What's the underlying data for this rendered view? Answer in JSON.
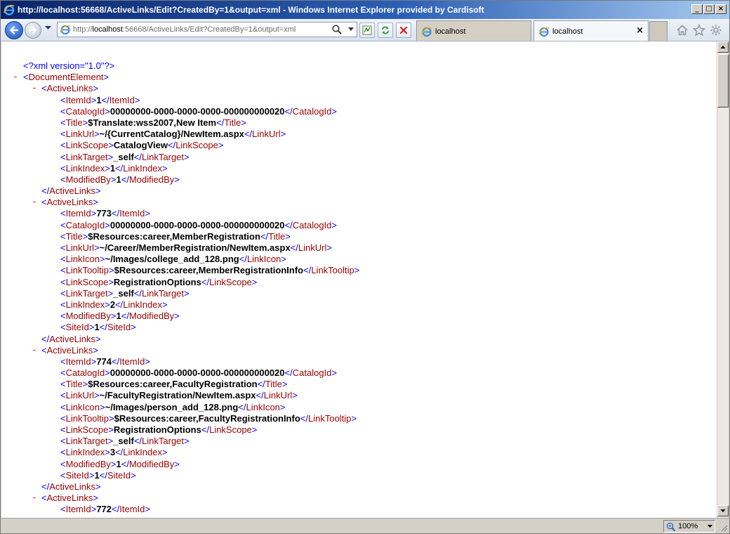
{
  "window": {
    "title": "http://localhost:56668/ActiveLinks/Edit?CreatedBy=1&output=xml - Windows Internet Explorer provided by Cardisoft",
    "minimize_glyph": "_",
    "maximize_glyph": "□",
    "close_glyph": "×"
  },
  "address": {
    "scheme": "http://",
    "host": "localhost",
    "rest": ":56668/ActiveLinks/Edit?CreatedBy=1&output=xml"
  },
  "tabs": [
    {
      "label": "localhost",
      "close": ""
    },
    {
      "label": "localhost",
      "close": "×"
    }
  ],
  "xml": {
    "lines": [
      {
        "indent": 1,
        "minus": false,
        "parts": [
          [
            "pi",
            "<?xml version=\"1.0\"?>"
          ]
        ]
      },
      {
        "indent": 1,
        "minus": true,
        "parts": [
          [
            "b",
            "<"
          ],
          [
            "tn",
            "DocumentElement"
          ],
          [
            "b",
            ">"
          ]
        ]
      },
      {
        "indent": 2,
        "minus": true,
        "parts": [
          [
            "b",
            "<"
          ],
          [
            "tn",
            "ActiveLinks"
          ],
          [
            "b",
            ">"
          ]
        ]
      },
      {
        "indent": 3,
        "minus": false,
        "parts": [
          [
            "b",
            "<"
          ],
          [
            "tn",
            "ItemId"
          ],
          [
            "b",
            ">"
          ],
          [
            "val",
            "1"
          ],
          [
            "b",
            "</"
          ],
          [
            "tn",
            "ItemId"
          ],
          [
            "b",
            ">"
          ]
        ]
      },
      {
        "indent": 3,
        "minus": false,
        "parts": [
          [
            "b",
            "<"
          ],
          [
            "tn",
            "CatalogId"
          ],
          [
            "b",
            ">"
          ],
          [
            "val",
            "00000000-0000-0000-0000-000000000020"
          ],
          [
            "b",
            "</"
          ],
          [
            "tn",
            "CatalogId"
          ],
          [
            "b",
            ">"
          ]
        ]
      },
      {
        "indent": 3,
        "minus": false,
        "parts": [
          [
            "b",
            "<"
          ],
          [
            "tn",
            "Title"
          ],
          [
            "b",
            ">"
          ],
          [
            "val",
            "$Translate:wss2007,New Item"
          ],
          [
            "b",
            "</"
          ],
          [
            "tn",
            "Title"
          ],
          [
            "b",
            ">"
          ]
        ]
      },
      {
        "indent": 3,
        "minus": false,
        "parts": [
          [
            "b",
            "<"
          ],
          [
            "tn",
            "LinkUrl"
          ],
          [
            "b",
            ">"
          ],
          [
            "val",
            "~/{CurrentCatalog}/NewItem.aspx"
          ],
          [
            "b",
            "</"
          ],
          [
            "tn",
            "LinkUrl"
          ],
          [
            "b",
            ">"
          ]
        ]
      },
      {
        "indent": 3,
        "minus": false,
        "parts": [
          [
            "b",
            "<"
          ],
          [
            "tn",
            "LinkScope"
          ],
          [
            "b",
            ">"
          ],
          [
            "val",
            "CatalogView"
          ],
          [
            "b",
            "</"
          ],
          [
            "tn",
            "LinkScope"
          ],
          [
            "b",
            ">"
          ]
        ]
      },
      {
        "indent": 3,
        "minus": false,
        "parts": [
          [
            "b",
            "<"
          ],
          [
            "tn",
            "LinkTarget"
          ],
          [
            "b",
            ">"
          ],
          [
            "val",
            "_self"
          ],
          [
            "b",
            "</"
          ],
          [
            "tn",
            "LinkTarget"
          ],
          [
            "b",
            ">"
          ]
        ]
      },
      {
        "indent": 3,
        "minus": false,
        "parts": [
          [
            "b",
            "<"
          ],
          [
            "tn",
            "LinkIndex"
          ],
          [
            "b",
            ">"
          ],
          [
            "val",
            "1"
          ],
          [
            "b",
            "</"
          ],
          [
            "tn",
            "LinkIndex"
          ],
          [
            "b",
            ">"
          ]
        ]
      },
      {
        "indent": 3,
        "minus": false,
        "parts": [
          [
            "b",
            "<"
          ],
          [
            "tn",
            "ModifiedBy"
          ],
          [
            "b",
            ">"
          ],
          [
            "val",
            "1"
          ],
          [
            "b",
            "</"
          ],
          [
            "tn",
            "ModifiedBy"
          ],
          [
            "b",
            ">"
          ]
        ]
      },
      {
        "indent": 2,
        "minus": false,
        "parts": [
          [
            "b",
            "</"
          ],
          [
            "tn",
            "ActiveLinks"
          ],
          [
            "b",
            ">"
          ]
        ]
      },
      {
        "indent": 2,
        "minus": true,
        "parts": [
          [
            "b",
            "<"
          ],
          [
            "tn",
            "ActiveLinks"
          ],
          [
            "b",
            ">"
          ]
        ]
      },
      {
        "indent": 3,
        "minus": false,
        "parts": [
          [
            "b",
            "<"
          ],
          [
            "tn",
            "ItemId"
          ],
          [
            "b",
            ">"
          ],
          [
            "val",
            "773"
          ],
          [
            "b",
            "</"
          ],
          [
            "tn",
            "ItemId"
          ],
          [
            "b",
            ">"
          ]
        ]
      },
      {
        "indent": 3,
        "minus": false,
        "parts": [
          [
            "b",
            "<"
          ],
          [
            "tn",
            "CatalogId"
          ],
          [
            "b",
            ">"
          ],
          [
            "val",
            "00000000-0000-0000-0000-000000000020"
          ],
          [
            "b",
            "</"
          ],
          [
            "tn",
            "CatalogId"
          ],
          [
            "b",
            ">"
          ]
        ]
      },
      {
        "indent": 3,
        "minus": false,
        "parts": [
          [
            "b",
            "<"
          ],
          [
            "tn",
            "Title"
          ],
          [
            "b",
            ">"
          ],
          [
            "val",
            "$Resources:career,MemberRegistration"
          ],
          [
            "b",
            "</"
          ],
          [
            "tn",
            "Title"
          ],
          [
            "b",
            ">"
          ]
        ]
      },
      {
        "indent": 3,
        "minus": false,
        "parts": [
          [
            "b",
            "<"
          ],
          [
            "tn",
            "LinkUrl"
          ],
          [
            "b",
            ">"
          ],
          [
            "val",
            "~/Career/MemberRegistration/NewItem.aspx"
          ],
          [
            "b",
            "</"
          ],
          [
            "tn",
            "LinkUrl"
          ],
          [
            "b",
            ">"
          ]
        ]
      },
      {
        "indent": 3,
        "minus": false,
        "parts": [
          [
            "b",
            "<"
          ],
          [
            "tn",
            "LinkIcon"
          ],
          [
            "b",
            ">"
          ],
          [
            "val",
            "~/Images/college_add_128.png"
          ],
          [
            "b",
            "</"
          ],
          [
            "tn",
            "LinkIcon"
          ],
          [
            "b",
            ">"
          ]
        ]
      },
      {
        "indent": 3,
        "minus": false,
        "parts": [
          [
            "b",
            "<"
          ],
          [
            "tn",
            "LinkTooltip"
          ],
          [
            "b",
            ">"
          ],
          [
            "val",
            "$Resources:career,MemberRegistrationInfo"
          ],
          [
            "b",
            "</"
          ],
          [
            "tn",
            "LinkTooltip"
          ],
          [
            "b",
            ">"
          ]
        ]
      },
      {
        "indent": 3,
        "minus": false,
        "parts": [
          [
            "b",
            "<"
          ],
          [
            "tn",
            "LinkScope"
          ],
          [
            "b",
            ">"
          ],
          [
            "val",
            "RegistrationOptions"
          ],
          [
            "b",
            "</"
          ],
          [
            "tn",
            "LinkScope"
          ],
          [
            "b",
            ">"
          ]
        ]
      },
      {
        "indent": 3,
        "minus": false,
        "parts": [
          [
            "b",
            "<"
          ],
          [
            "tn",
            "LinkTarget"
          ],
          [
            "b",
            ">"
          ],
          [
            "val",
            "_self"
          ],
          [
            "b",
            "</"
          ],
          [
            "tn",
            "LinkTarget"
          ],
          [
            "b",
            ">"
          ]
        ]
      },
      {
        "indent": 3,
        "minus": false,
        "parts": [
          [
            "b",
            "<"
          ],
          [
            "tn",
            "LinkIndex"
          ],
          [
            "b",
            ">"
          ],
          [
            "val",
            "2"
          ],
          [
            "b",
            "</"
          ],
          [
            "tn",
            "LinkIndex"
          ],
          [
            "b",
            ">"
          ]
        ]
      },
      {
        "indent": 3,
        "minus": false,
        "parts": [
          [
            "b",
            "<"
          ],
          [
            "tn",
            "ModifiedBy"
          ],
          [
            "b",
            ">"
          ],
          [
            "val",
            "1"
          ],
          [
            "b",
            "</"
          ],
          [
            "tn",
            "ModifiedBy"
          ],
          [
            "b",
            ">"
          ]
        ]
      },
      {
        "indent": 3,
        "minus": false,
        "parts": [
          [
            "b",
            "<"
          ],
          [
            "tn",
            "SiteId"
          ],
          [
            "b",
            ">"
          ],
          [
            "val",
            "1"
          ],
          [
            "b",
            "</"
          ],
          [
            "tn",
            "SiteId"
          ],
          [
            "b",
            ">"
          ]
        ]
      },
      {
        "indent": 2,
        "minus": false,
        "parts": [
          [
            "b",
            "</"
          ],
          [
            "tn",
            "ActiveLinks"
          ],
          [
            "b",
            ">"
          ]
        ]
      },
      {
        "indent": 2,
        "minus": true,
        "parts": [
          [
            "b",
            "<"
          ],
          [
            "tn",
            "ActiveLinks"
          ],
          [
            "b",
            ">"
          ]
        ]
      },
      {
        "indent": 3,
        "minus": false,
        "parts": [
          [
            "b",
            "<"
          ],
          [
            "tn",
            "ItemId"
          ],
          [
            "b",
            ">"
          ],
          [
            "val",
            "774"
          ],
          [
            "b",
            "</"
          ],
          [
            "tn",
            "ItemId"
          ],
          [
            "b",
            ">"
          ]
        ]
      },
      {
        "indent": 3,
        "minus": false,
        "parts": [
          [
            "b",
            "<"
          ],
          [
            "tn",
            "CatalogId"
          ],
          [
            "b",
            ">"
          ],
          [
            "val",
            "00000000-0000-0000-0000-000000000020"
          ],
          [
            "b",
            "</"
          ],
          [
            "tn",
            "CatalogId"
          ],
          [
            "b",
            ">"
          ]
        ]
      },
      {
        "indent": 3,
        "minus": false,
        "parts": [
          [
            "b",
            "<"
          ],
          [
            "tn",
            "Title"
          ],
          [
            "b",
            ">"
          ],
          [
            "val",
            "$Resources:career,FacultyRegistration"
          ],
          [
            "b",
            "</"
          ],
          [
            "tn",
            "Title"
          ],
          [
            "b",
            ">"
          ]
        ]
      },
      {
        "indent": 3,
        "minus": false,
        "parts": [
          [
            "b",
            "<"
          ],
          [
            "tn",
            "LinkUrl"
          ],
          [
            "b",
            ">"
          ],
          [
            "val",
            "~/FacultyRegistration/NewItem.aspx"
          ],
          [
            "b",
            "</"
          ],
          [
            "tn",
            "LinkUrl"
          ],
          [
            "b",
            ">"
          ]
        ]
      },
      {
        "indent": 3,
        "minus": false,
        "parts": [
          [
            "b",
            "<"
          ],
          [
            "tn",
            "LinkIcon"
          ],
          [
            "b",
            ">"
          ],
          [
            "val",
            "~/Images/person_add_128.png"
          ],
          [
            "b",
            "</"
          ],
          [
            "tn",
            "LinkIcon"
          ],
          [
            "b",
            ">"
          ]
        ]
      },
      {
        "indent": 3,
        "minus": false,
        "parts": [
          [
            "b",
            "<"
          ],
          [
            "tn",
            "LinkTooltip"
          ],
          [
            "b",
            ">"
          ],
          [
            "val",
            "$Resources:career,FacultyRegistrationInfo"
          ],
          [
            "b",
            "</"
          ],
          [
            "tn",
            "LinkTooltip"
          ],
          [
            "b",
            ">"
          ]
        ]
      },
      {
        "indent": 3,
        "minus": false,
        "parts": [
          [
            "b",
            "<"
          ],
          [
            "tn",
            "LinkScope"
          ],
          [
            "b",
            ">"
          ],
          [
            "val",
            "RegistrationOptions"
          ],
          [
            "b",
            "</"
          ],
          [
            "tn",
            "LinkScope"
          ],
          [
            "b",
            ">"
          ]
        ]
      },
      {
        "indent": 3,
        "minus": false,
        "parts": [
          [
            "b",
            "<"
          ],
          [
            "tn",
            "LinkTarget"
          ],
          [
            "b",
            ">"
          ],
          [
            "val",
            "_self"
          ],
          [
            "b",
            "</"
          ],
          [
            "tn",
            "LinkTarget"
          ],
          [
            "b",
            ">"
          ]
        ]
      },
      {
        "indent": 3,
        "minus": false,
        "parts": [
          [
            "b",
            "<"
          ],
          [
            "tn",
            "LinkIndex"
          ],
          [
            "b",
            ">"
          ],
          [
            "val",
            "3"
          ],
          [
            "b",
            "</"
          ],
          [
            "tn",
            "LinkIndex"
          ],
          [
            "b",
            ">"
          ]
        ]
      },
      {
        "indent": 3,
        "minus": false,
        "parts": [
          [
            "b",
            "<"
          ],
          [
            "tn",
            "ModifiedBy"
          ],
          [
            "b",
            ">"
          ],
          [
            "val",
            "1"
          ],
          [
            "b",
            "</"
          ],
          [
            "tn",
            "ModifiedBy"
          ],
          [
            "b",
            ">"
          ]
        ]
      },
      {
        "indent": 3,
        "minus": false,
        "parts": [
          [
            "b",
            "<"
          ],
          [
            "tn",
            "SiteId"
          ],
          [
            "b",
            ">"
          ],
          [
            "val",
            "1"
          ],
          [
            "b",
            "</"
          ],
          [
            "tn",
            "SiteId"
          ],
          [
            "b",
            ">"
          ]
        ]
      },
      {
        "indent": 2,
        "minus": false,
        "parts": [
          [
            "b",
            "</"
          ],
          [
            "tn",
            "ActiveLinks"
          ],
          [
            "b",
            ">"
          ]
        ]
      },
      {
        "indent": 2,
        "minus": true,
        "parts": [
          [
            "b",
            "<"
          ],
          [
            "tn",
            "ActiveLinks"
          ],
          [
            "b",
            ">"
          ]
        ]
      },
      {
        "indent": 3,
        "minus": false,
        "parts": [
          [
            "b",
            "<"
          ],
          [
            "tn",
            "ItemId"
          ],
          [
            "b",
            ">"
          ],
          [
            "val",
            "772"
          ],
          [
            "b",
            "</"
          ],
          [
            "tn",
            "ItemId"
          ],
          [
            "b",
            ">"
          ]
        ]
      }
    ]
  },
  "status": {
    "zoom": "100%"
  },
  "colors": {
    "markup": "#0000ff",
    "tag_name": "#990000",
    "collapse_minus": "#ff0000",
    "value": "#000000"
  }
}
